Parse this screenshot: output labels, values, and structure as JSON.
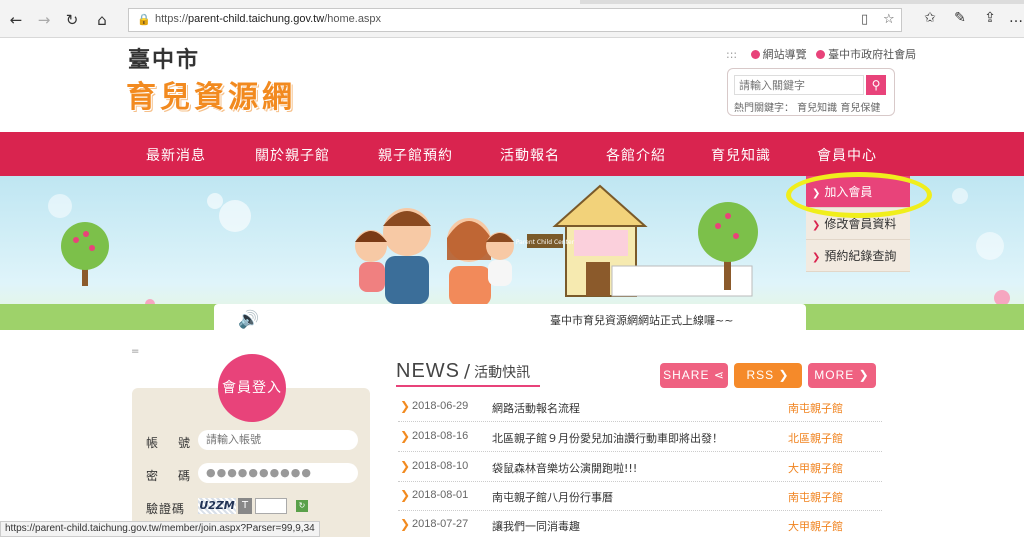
{
  "browser": {
    "url_prefix": "https://",
    "url_domain": "parent-child.taichung.gov.tw",
    "url_path": "/home.aspx",
    "status_url": "https://parent-child.taichung.gov.tw/member/join.aspx?Parser=99,9,34"
  },
  "header": {
    "logo_top": "臺中市",
    "logo_main": "育兒資源網",
    "toplinks": [
      "網站導覽",
      "臺中市政府社會局"
    ],
    "toplinks_sep": ":::",
    "search_placeholder": "請輸入關鍵字",
    "hot_keywords": "熱門關鍵字： 育兒知識 育兒保健"
  },
  "nav": {
    "items": [
      "最新消息",
      "關於親子館",
      "親子館預約",
      "活動報名",
      "各館介紹",
      "育兒知識",
      "會員中心"
    ]
  },
  "member_menu": {
    "items": [
      "加入會員",
      "修改會員資料",
      "預約紀錄查詢"
    ]
  },
  "banner": {
    "marquee": "臺中市育兒資源網網站正式上線囉~~",
    "house_sign": "Parent Child Center"
  },
  "login": {
    "title": "會員登入",
    "account_label": "帳　號",
    "account_placeholder": "請輸入帳號",
    "password_label": "密　碼",
    "password_mask": "●●●●●●●●●●",
    "captcha_label": "驗證碼",
    "captcha_code": "U2ZM",
    "captcha_btn": "T",
    "tiny": "="
  },
  "news": {
    "title_en": "NEWS",
    "title_zh": "活動快訊",
    "buttons": [
      "SHARE",
      "RSS",
      "MORE"
    ],
    "rows": [
      {
        "date": "2018-06-29",
        "title": "網路活動報名流程",
        "source": "南屯親子館"
      },
      {
        "date": "2018-08-16",
        "title": "北區親子館９月份愛兒加油讚行動車即將出發！",
        "source": "北區親子館"
      },
      {
        "date": "2018-08-10",
        "title": "袋鼠森林音樂坊公演開跑啦!!!",
        "source": "大甲親子館"
      },
      {
        "date": "2018-08-01",
        "title": "南屯親子館八月份行事曆",
        "source": "南屯親子館"
      },
      {
        "date": "2018-07-27",
        "title": "讓我們一同消毒趣",
        "source": "大甲親子館"
      }
    ]
  },
  "colors": {
    "brand_red": "#d9244f",
    "pink": "#e8437a",
    "orange": "#f28a1f",
    "highlight": "#f0ee1c"
  }
}
